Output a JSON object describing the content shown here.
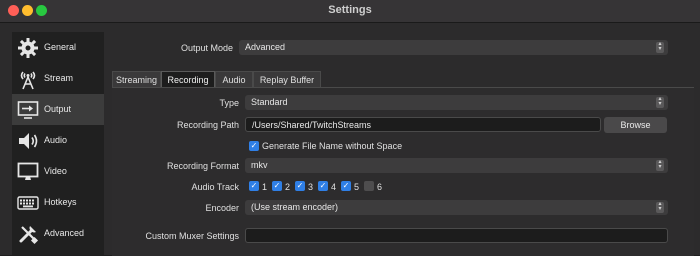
{
  "window": {
    "title": "Settings"
  },
  "sidebar": {
    "items": [
      {
        "label": "General",
        "icon": "gear-icon"
      },
      {
        "label": "Stream",
        "icon": "antenna-icon"
      },
      {
        "label": "Output",
        "icon": "output-icon"
      },
      {
        "label": "Audio",
        "icon": "speaker-icon"
      },
      {
        "label": "Video",
        "icon": "monitor-icon"
      },
      {
        "label": "Hotkeys",
        "icon": "keyboard-icon"
      },
      {
        "label": "Advanced",
        "icon": "tools-icon"
      }
    ],
    "active_index": 2
  },
  "output_mode": {
    "label": "Output Mode",
    "value": "Advanced"
  },
  "tabs": [
    "Streaming",
    "Recording",
    "Audio",
    "Replay Buffer"
  ],
  "active_tab": "Recording",
  "recording": {
    "type": {
      "label": "Type",
      "value": "Standard"
    },
    "path": {
      "label": "Recording Path",
      "value": "/Users/Shared/TwitchStreams",
      "browse": "Browse"
    },
    "generate_name": {
      "label": "Generate File Name without Space",
      "checked": true
    },
    "format": {
      "label": "Recording Format",
      "value": "mkv"
    },
    "audio_track": {
      "label": "Audio Track",
      "tracks": [
        {
          "label": "1",
          "checked": true
        },
        {
          "label": "2",
          "checked": true
        },
        {
          "label": "3",
          "checked": true
        },
        {
          "label": "4",
          "checked": true
        },
        {
          "label": "5",
          "checked": true
        },
        {
          "label": "6",
          "checked": false
        }
      ]
    },
    "encoder": {
      "label": "Encoder",
      "value": "(Use stream encoder)"
    },
    "muxer": {
      "label": "Custom Muxer Settings",
      "value": ""
    }
  },
  "colors": {
    "accent": "#2f7fe6",
    "background": "#2c2b2c",
    "sidebar": "#202020"
  }
}
